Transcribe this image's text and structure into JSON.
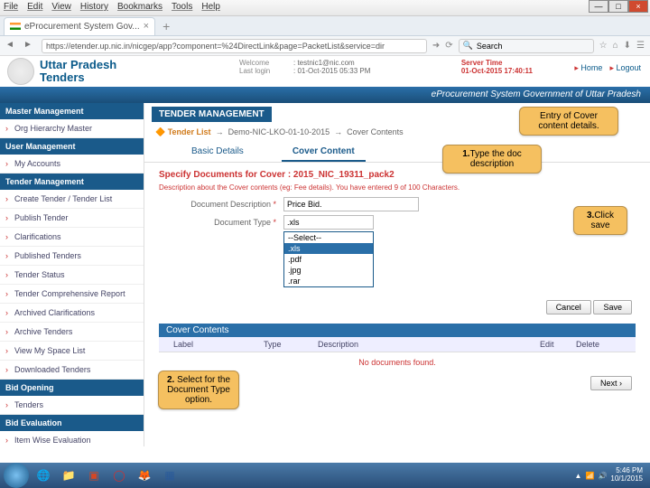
{
  "menubar": [
    "File",
    "Edit",
    "View",
    "History",
    "Bookmarks",
    "Tools",
    "Help"
  ],
  "tab_title": "eProcurement System Gov...",
  "url": "https://etender.up.nic.in/nicgep/app?component=%24DirectLink&page=PacketList&service=dir",
  "search_placeholder": "Search",
  "site": {
    "title1": "Uttar Pradesh",
    "title2": "Tenders"
  },
  "header_info": {
    "welcome_label": "Welcome",
    "welcome_value": ": testnic1@nic.com",
    "login_label": "Last login",
    "login_value": ": 01-Oct-2015 05:33 PM"
  },
  "server_time": {
    "label": "Server Time",
    "value": "01-Oct-2015 17:40:11"
  },
  "header_links": {
    "home": "Home",
    "logout": "Logout"
  },
  "bluebar": "eProcurement System Government of Uttar Pradesh",
  "sidebar": {
    "s1": "Master Management",
    "i1": "Org Hierarchy Master",
    "s2": "User Management",
    "i2": "My Accounts",
    "s3": "Tender Management",
    "items3": [
      "Create Tender / Tender List",
      "Publish Tender",
      "Clarifications",
      "Published Tenders",
      "Tender Status",
      "Tender Comprehensive Report",
      "Archived Clarifications",
      "Archive Tenders",
      "View My Space List",
      "Downloaded Tenders"
    ],
    "s4": "Bid Opening",
    "i4": "Tenders",
    "s5": "Bid Evaluation",
    "i5": "Item Wise Evaluation"
  },
  "content": {
    "section": "TENDER MANAGEMENT",
    "breadcrumb_back": "Tender List",
    "breadcrumb_mid": "Demo-NIC-LKO-01-10-2015",
    "breadcrumb_last": "Cover Contents",
    "tab_basic": "Basic Details",
    "tab_cover": "Cover Content",
    "form_title": "Specify Documents for Cover : 2015_NIC_19311_pack2",
    "form_hint": "Description about the Cover contents (eg: Fee details). You have entered 9 of 100 Characters.",
    "desc_label": "Document Description",
    "desc_value": "Price Bid.",
    "type_label": "Document Type",
    "type_selected": ".xls",
    "type_options": [
      "--Select--",
      ".xls",
      ".pdf",
      ".jpg",
      ".rar"
    ],
    "cancel": "Cancel",
    "save": "Save",
    "cover_contents": "Cover Contents",
    "grid": [
      "Label",
      "Type",
      "Description",
      "Edit",
      "Delete"
    ],
    "no_docs": "No documents found.",
    "next": "Next"
  },
  "annotations": {
    "a1": "Entry of Cover content details.",
    "a2_bold": "1.",
    "a2_text": "Type the doc description",
    "a3_bold": "3.",
    "a3_text": "Click save",
    "a4_bold": "2.",
    "a4_text": " Select for the Document Type option."
  },
  "tray": {
    "time": "5:46 PM",
    "date": "10/1/2015"
  }
}
